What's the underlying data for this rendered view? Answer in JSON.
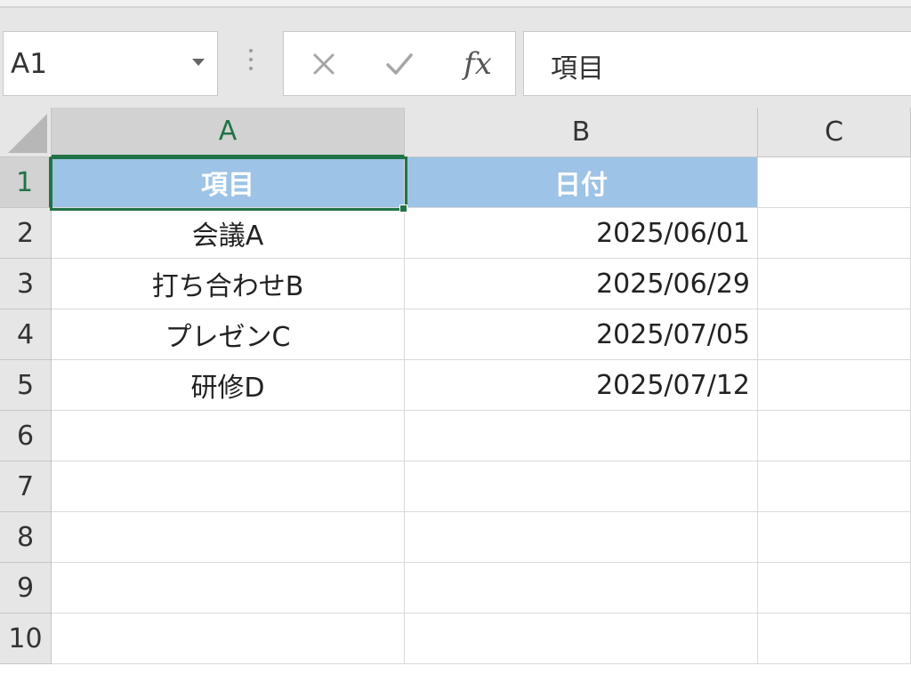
{
  "name_box": {
    "value": "A1"
  },
  "formula_bar": {
    "function_label": "fx",
    "value": "項目"
  },
  "columns": [
    "A",
    "B",
    "C"
  ],
  "rows": [
    "1",
    "2",
    "3",
    "4",
    "5",
    "6",
    "7",
    "8",
    "9",
    "10"
  ],
  "table": {
    "header": {
      "a": "項目",
      "b": "日付"
    },
    "records": [
      {
        "a": "会議A",
        "b": "2025/06/01"
      },
      {
        "a": "打ち合わせB",
        "b": "2025/06/29"
      },
      {
        "a": "プレゼンC",
        "b": "2025/07/05"
      },
      {
        "a": "研修D",
        "b": "2025/07/12"
      }
    ]
  },
  "colors": {
    "accent": "#217346",
    "header_fill": "#9dc3e6",
    "header_text": "#ffffff"
  },
  "icons": {
    "cancel": "close-icon",
    "enter": "check-icon",
    "function": "fx-icon",
    "dropdown": "chevron-down-icon"
  }
}
